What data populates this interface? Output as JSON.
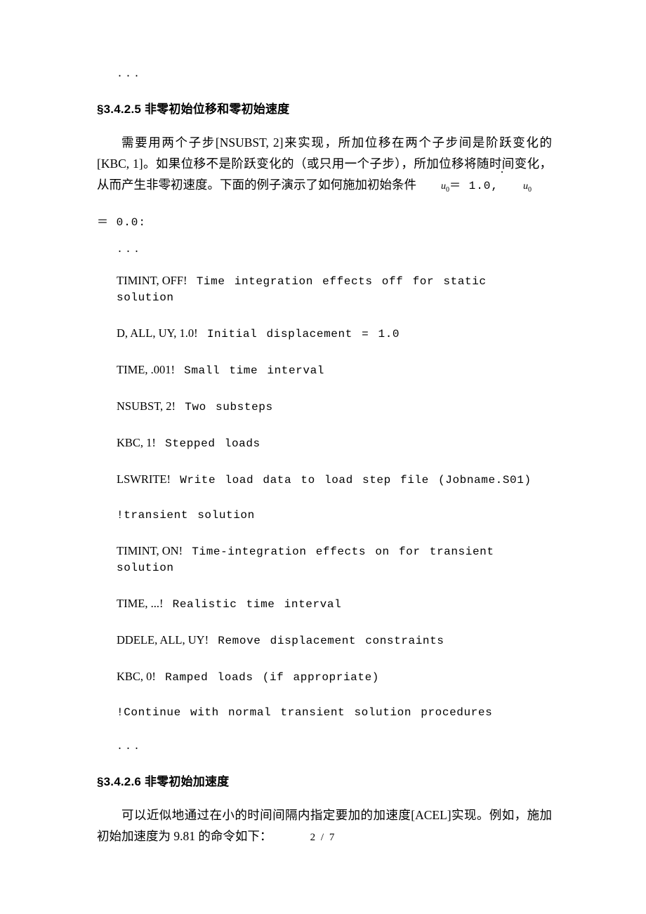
{
  "document": {
    "page_footer": "2 / 7",
    "top_ellipsis": "...",
    "mid_ellipsis": "...",
    "end_ellipsis": "..."
  },
  "section_1": {
    "heading": "§3.4.2.5 非零初始位移和零初始速度",
    "paragraph_part1": "需要用两个子步[NSUBST, 2]来实现，所加位移在两个子步间是阶跃变化的[KBC, 1]。如果位移不是阶跃变化的（或只用一个子步），所加位移将随时间变化，从而产生非零初速度。下面的例子演示了如何施加初始条件",
    "math": {
      "u_symbol": "u",
      "u_subscript": "0",
      "equals_value": "＝ 1.0,",
      "udot_symbol": "u",
      "udot_subscript": "0",
      "second_line": "＝ 0.0:"
    }
  },
  "code": {
    "lines": [
      {
        "command": "TIMINT, OFF!",
        "comment": "Time integration effects off for static solution"
      },
      {
        "command": "D, ALL, UY, 1.0!",
        "comment": "Initial displacement = 1.0"
      },
      {
        "command": "TIME, .001!",
        "comment": "Small time interval"
      },
      {
        "command": "NSUBST, 2!",
        "comment": "Two substeps"
      },
      {
        "command": "KBC, 1!",
        "comment": "Stepped loads"
      },
      {
        "command": "LSWRITE!",
        "comment": "Write load data to load step file (Jobname.S01)"
      },
      {
        "command": "",
        "comment": "!transient solution"
      },
      {
        "command": "TIMINT, ON!",
        "comment": "Time-integration effects on for transient solution"
      },
      {
        "command": "TIME, ...!",
        "comment": "Realistic time interval"
      },
      {
        "command": "DDELE, ALL, UY!",
        "comment": "Remove displacement constraints"
      },
      {
        "command": "KBC, 0!",
        "comment": "Ramped loads (if appropriate)"
      },
      {
        "command": "",
        "comment": "!Continue with normal transient solution procedures"
      }
    ]
  },
  "section_2": {
    "heading": "§3.4.2.6 非零初始加速度",
    "paragraph": "可以近似地通过在小的时间间隔内指定要加的加速度[ACEL]实现。例如，施加初始加速度为 9.81 的命令如下："
  }
}
